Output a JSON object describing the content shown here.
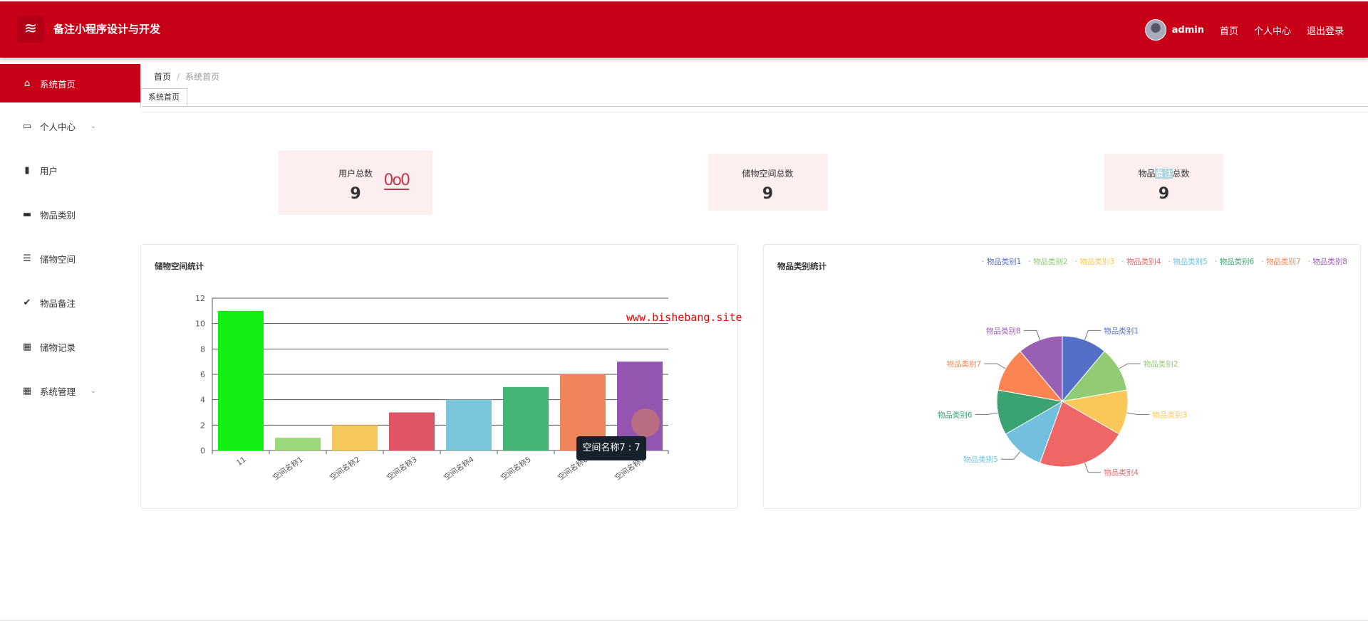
{
  "header": {
    "title": "备注小程序设计与开发",
    "user": "admin",
    "links": [
      "首页",
      "个人中心",
      "退出登录"
    ]
  },
  "sidebar": {
    "items": [
      {
        "label": "系统首页",
        "icon": "home-icon",
        "glyph": "⌂",
        "active": true
      },
      {
        "label": "个人中心",
        "icon": "card-icon",
        "glyph": "▭",
        "expand": true
      },
      {
        "label": "用户",
        "icon": "book-icon",
        "glyph": "▮"
      },
      {
        "label": "物品类别",
        "icon": "monitor-icon",
        "glyph": "▬"
      },
      {
        "label": "储物空间",
        "icon": "sliders-icon",
        "glyph": "☰"
      },
      {
        "label": "物品备注",
        "icon": "clipboard-check-icon",
        "glyph": "✔"
      },
      {
        "label": "储物记录",
        "icon": "grid-icon",
        "glyph": "▦"
      },
      {
        "label": "系统管理",
        "icon": "grid-icon",
        "glyph": "▦",
        "expand": true
      }
    ]
  },
  "breadcrumb": {
    "home": "首页",
    "current": "系统首页"
  },
  "tab": "系统首页",
  "stats": [
    {
      "label": "用户总数",
      "value": "9"
    },
    {
      "label": "储物空间总数",
      "value": "9"
    },
    {
      "label_pre": "物品",
      "label_hl": "备注",
      "label_post": "总数",
      "value": "9"
    }
  ],
  "watermark": "www.bishebang.site",
  "tooltip": "空间名称7 : 7",
  "chart_data": [
    {
      "type": "bar",
      "title": "储物空间统计",
      "categories": [
        "11",
        "空间名称1",
        "空间名称2",
        "空间名称3",
        "空间名称4",
        "空间名称5",
        "空间名称6",
        "空间名称7"
      ],
      "values": [
        11,
        1,
        2,
        3,
        4,
        5,
        6,
        7
      ],
      "colors": [
        "#11ee11",
        "#99d97a",
        "#f5c95c",
        "#e05565",
        "#7ac6da",
        "#44b477",
        "#f0845a",
        "#9355b0"
      ],
      "ylim": [
        0,
        12
      ],
      "yticks": [
        0,
        2,
        4,
        6,
        8,
        10,
        12
      ],
      "grid": true
    },
    {
      "type": "pie",
      "title": "物品类别统计",
      "categories": [
        "物品类别1",
        "物品类别2",
        "物品类别3",
        "物品类别4",
        "物品类别5",
        "物品类别6",
        "物品类别7",
        "物品类别8"
      ],
      "values": [
        1,
        1,
        1,
        2,
        1,
        1,
        1,
        1
      ],
      "colors": [
        "#5470c6",
        "#91cc75",
        "#fac858",
        "#ee6666",
        "#73c0de",
        "#3ba272",
        "#fc8452",
        "#9a60b4"
      ],
      "legend": "top-right"
    }
  ]
}
